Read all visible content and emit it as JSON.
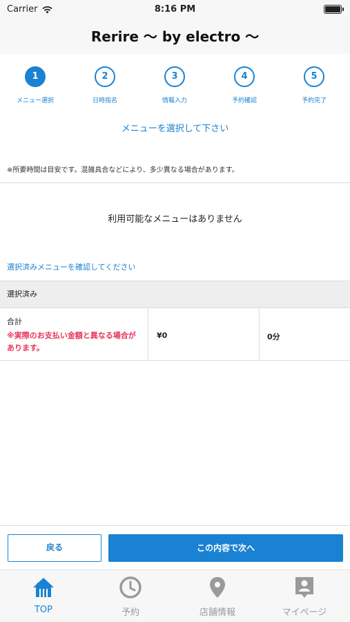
{
  "status_bar": {
    "carrier": "Carrier",
    "time": "8:16 PM"
  },
  "nav": {
    "title": "Rerire 〜 by electro 〜"
  },
  "steps": [
    {
      "number": "1",
      "label": "メニュー選択"
    },
    {
      "number": "2",
      "label": "日時指名"
    },
    {
      "number": "3",
      "label": "情報入力"
    },
    {
      "number": "4",
      "label": "予約確認"
    },
    {
      "number": "5",
      "label": "予約完了"
    }
  ],
  "main": {
    "instruction": "メニューを選択して下さい",
    "notice": "※所要時間は目安です。混雑具合などにより、多少異なる場合があります。",
    "empty_message": "利用可能なメニューはありません",
    "confirm_link": "選択済みメニューを確認してください"
  },
  "selected": {
    "header": "選択済み",
    "total_label": "合計",
    "total_note": "※実際のお支払い金額と異なる場合があります。",
    "price": "¥0",
    "duration": "0分"
  },
  "actions": {
    "back_label": "戻る",
    "next_label": "この内容で次へ"
  },
  "tab_bar": {
    "tabs": [
      {
        "label": "TOP",
        "icon": "home-icon"
      },
      {
        "label": "予約",
        "icon": "clock-icon"
      },
      {
        "label": "店舗情報",
        "icon": "map-pin-icon"
      },
      {
        "label": "マイページ",
        "icon": "profile-icon"
      }
    ]
  },
  "colors": {
    "accent": "#1a82d2",
    "warning": "#e8335a",
    "inactive": "#9a9a9a"
  }
}
